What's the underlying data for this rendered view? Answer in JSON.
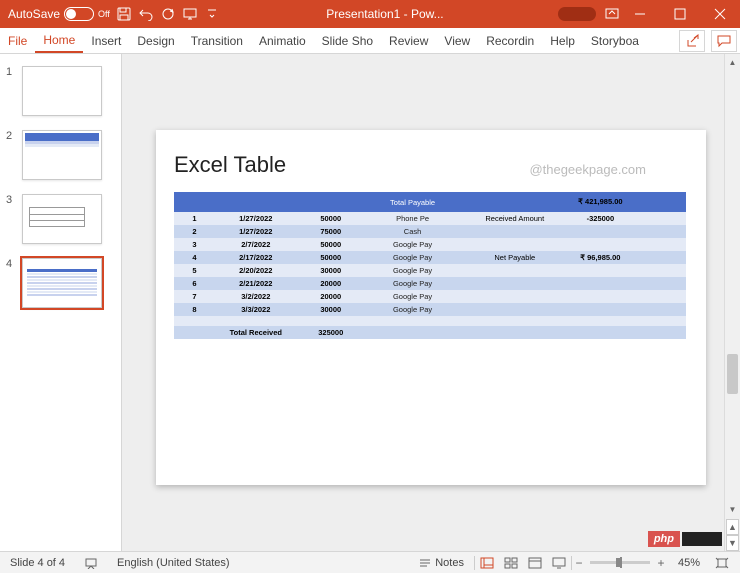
{
  "titlebar": {
    "autosave_label": "AutoSave",
    "autosave_state": "Off",
    "title": "Presentation1 - Pow..."
  },
  "ribbon": {
    "tabs": [
      "File",
      "Home",
      "Insert",
      "Design",
      "Transition",
      "Animatio",
      "Slide Sho",
      "Review",
      "View",
      "Recordin",
      "Help",
      "Storyboa"
    ],
    "active_index": 1
  },
  "thumbnails": [
    {
      "num": "1"
    },
    {
      "num": "2"
    },
    {
      "num": "3"
    },
    {
      "num": "4"
    }
  ],
  "selected_thumbnail": 3,
  "slide": {
    "title": "Excel Table",
    "watermark": "@thegeekpage.com",
    "header": {
      "total_payable_label": "Total Payable",
      "total_payable_value": "₹ 421,985.00"
    },
    "rows": [
      {
        "idx": "1",
        "date": "1/27/2022",
        "amount": "50000",
        "mode": "Phone Pe",
        "right_label": "Received Amount",
        "right_value": "-325000"
      },
      {
        "idx": "2",
        "date": "1/27/2022",
        "amount": "75000",
        "mode": "Cash",
        "right_label": "",
        "right_value": ""
      },
      {
        "idx": "3",
        "date": "2/7/2022",
        "amount": "50000",
        "mode": "Google Pay",
        "right_label": "",
        "right_value": ""
      },
      {
        "idx": "4",
        "date": "2/17/2022",
        "amount": "50000",
        "mode": "Google Pay",
        "right_label": "Net Payable",
        "right_value": "₹ 96,985.00"
      },
      {
        "idx": "5",
        "date": "2/20/2022",
        "amount": "30000",
        "mode": "Google Pay",
        "right_label": "",
        "right_value": ""
      },
      {
        "idx": "6",
        "date": "2/21/2022",
        "amount": "20000",
        "mode": "Google Pay",
        "right_label": "",
        "right_value": ""
      },
      {
        "idx": "7",
        "date": "3/2/2022",
        "amount": "20000",
        "mode": "Google Pay",
        "right_label": "",
        "right_value": ""
      },
      {
        "idx": "8",
        "date": "3/3/2022",
        "amount": "30000",
        "mode": "Google Pay",
        "right_label": "",
        "right_value": ""
      }
    ],
    "totals": {
      "label": "Total Received",
      "value": "325000"
    }
  },
  "statusbar": {
    "slide_pos": "Slide 4 of 4",
    "language": "English (United States)",
    "notes_label": "Notes",
    "zoom_value": "45%"
  },
  "badge": {
    "text": "php"
  }
}
